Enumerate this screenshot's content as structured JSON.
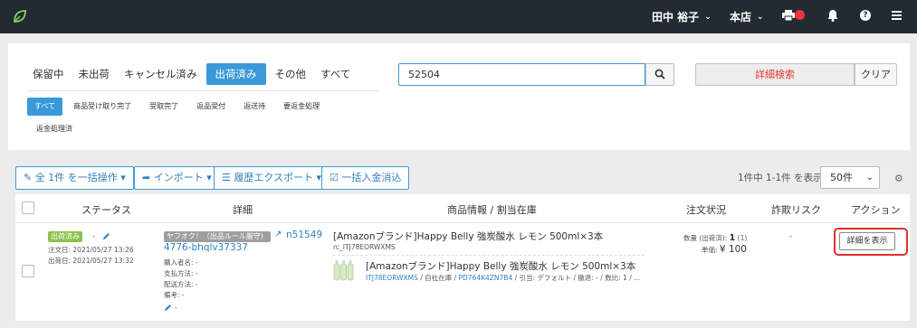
{
  "header": {
    "user_name": "田中 裕子",
    "store_label": "本店"
  },
  "status_tabs": [
    "保留中",
    "未出荷",
    "キャンセル済み",
    "出荷済み",
    "その他",
    "すべて"
  ],
  "active_status_tab": "出荷済み",
  "sub_tabs": [
    "すべて",
    "商品受け取り完了",
    "受取完了",
    "返品受付",
    "返送待",
    "要返金処理"
  ],
  "sub_tab_extra": "返金処理済",
  "search": {
    "value": "52504"
  },
  "advanced_search_label": "詳細検索",
  "clear_label": "クリア",
  "toolbar": {
    "bulk_label": "全 1件 を一括操作",
    "import_label": "インポート",
    "export_label": "履歴エクスポート",
    "payment_label": "一括入金消込",
    "count_text": "1件中 1-1件 を表示",
    "per_page": "50件"
  },
  "columns": [
    "ステータス",
    "詳細",
    "商品情報 / 割当在庫",
    "注文状況",
    "詐欺リスク",
    "アクション"
  ],
  "order": {
    "status_badge": "出荷済み",
    "status_dash": "-",
    "order_date": "注文日: 2021/05/27 13:26",
    "ship_date": "出荷日: 2021/05/27 13:32",
    "channel_badge": "ヤフオク！（出品ルール厳守）",
    "order_no": "n51549",
    "order_id": "4776-bhqlv37337",
    "buyer": "購入者名: -",
    "payment": "支払方法: -",
    "delivery": "配送方法: -",
    "note": "備考: -",
    "edit_dash": "-",
    "product_title": "[Amazonブランド]Happy Belly 強炭酸水 レモン 500ml×3本",
    "product_sku": "rc_ITJ78EORWXMS",
    "stock_title": "[Amazonブランド]Happy Belly 強炭酸水 レモン 500ml×3本",
    "stock_sku": "ITJ78EORWXMS",
    "stock_loc_pre": " / 自社在庫 / ",
    "stock_code": "PD764K4ZN7B4",
    "stock_tail": " / 引当: デフォルト / 撤退: - / 数比: 1 / ...",
    "qty_label": "数量 (出荷済):",
    "qty_value": "1",
    "qty_sub": "(1)",
    "unit_label": "単価:",
    "unit_value": "¥ 100",
    "fraud": "-",
    "action_label": "詳細を表示"
  },
  "colors": {
    "accent": "#3a9ad9",
    "badge_green": "#8bc34a",
    "badge_gray": "#9e9e9e",
    "danger": "#e32d2d"
  }
}
